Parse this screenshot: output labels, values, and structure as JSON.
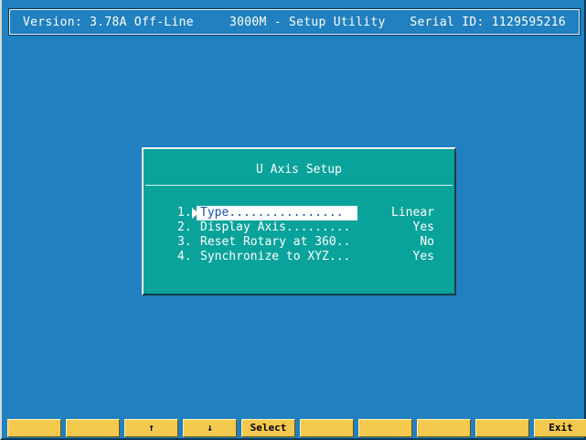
{
  "header": {
    "version": "Version: 3.78A Off-Line",
    "title": "3000M - Setup Utility",
    "serial": "Serial ID: 1129595216"
  },
  "dialog": {
    "title": "U Axis Setup",
    "items": [
      {
        "num": "1.",
        "label": "Type................",
        "value": "Linear",
        "selected": true
      },
      {
        "num": "2.",
        "label": "Display Axis.........",
        "value": "Yes"
      },
      {
        "num": "3.",
        "label": "Reset Rotary at 360..",
        "value": "No"
      },
      {
        "num": "4.",
        "label": "Synchronize to XYZ...",
        "value": "Yes"
      }
    ]
  },
  "fkeys": [
    "",
    "",
    "↑",
    "↓",
    "Select",
    "",
    "",
    "",
    "",
    "Exit"
  ],
  "colors": {
    "background": "#2180c0",
    "dialog": "#0aa39b",
    "fkey": "#f3c94e",
    "highlight_text": "#1a4fb0"
  }
}
